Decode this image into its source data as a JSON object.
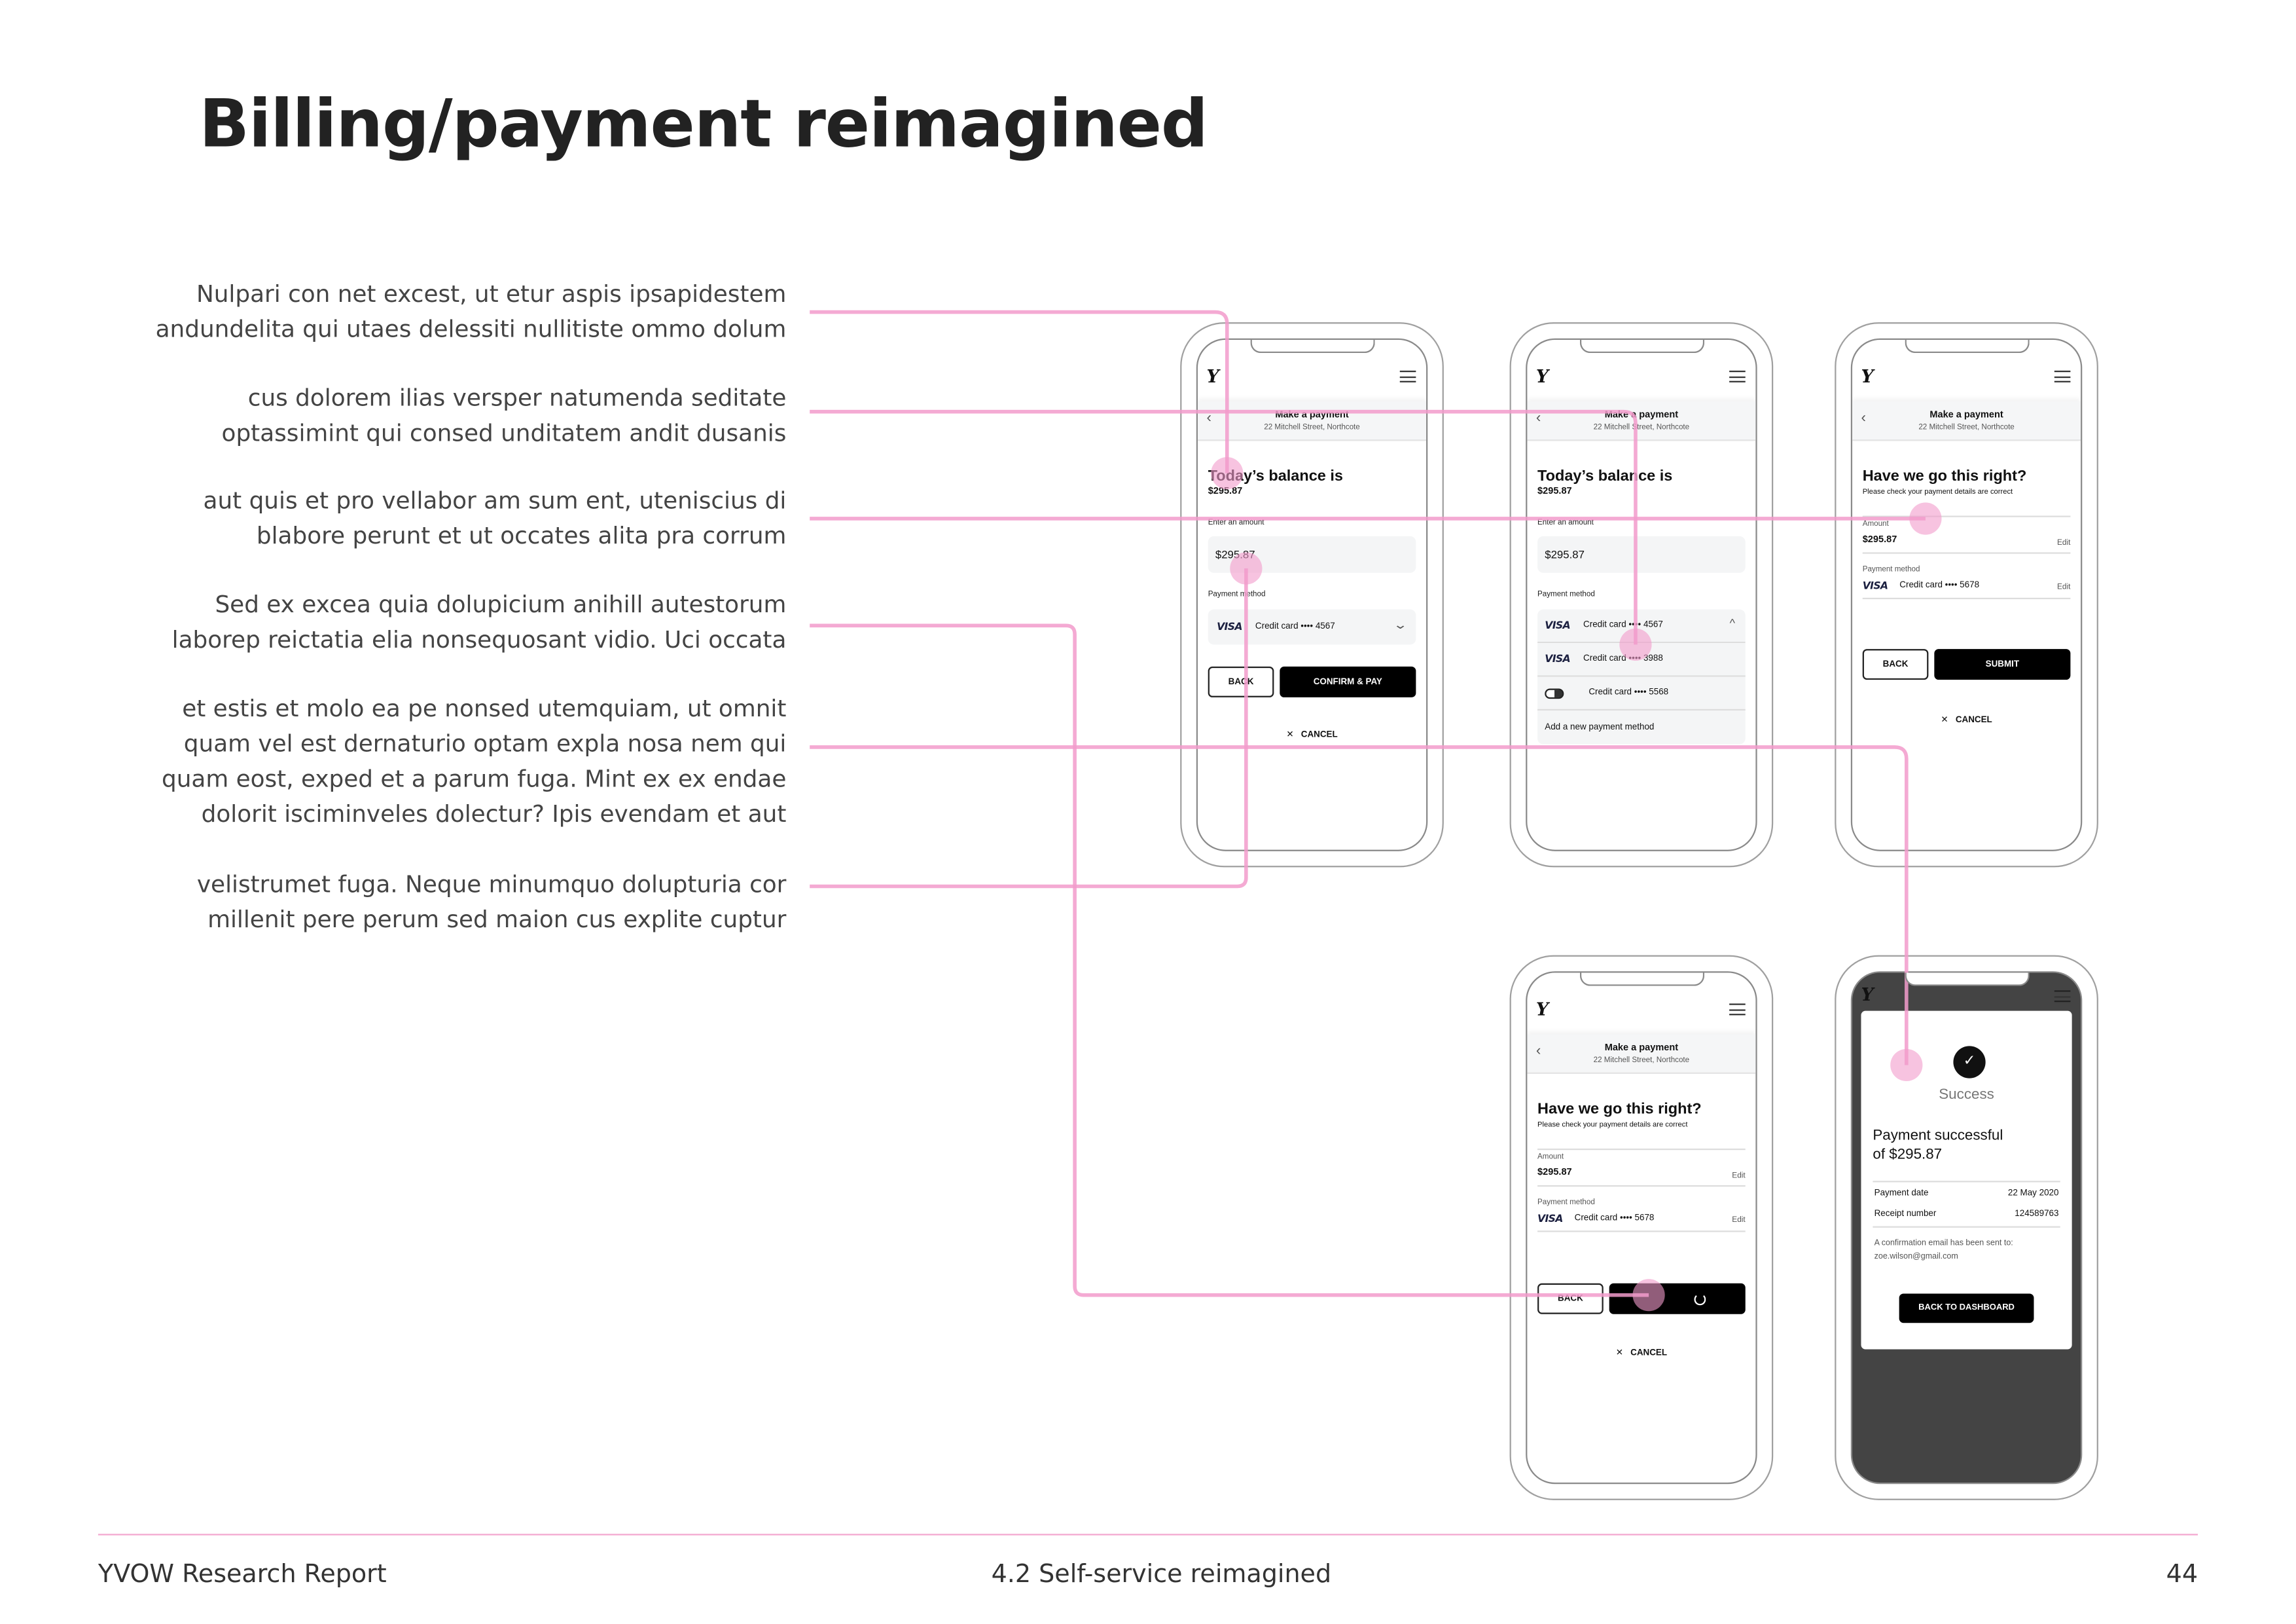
{
  "title": "Billing/payment reimagined",
  "intro": [
    [
      "Nulpari con net excest, ut etur aspis ipsapidestem",
      "andundelita qui utaes delessiti nullitiste ommo dolum"
    ],
    [
      "cus dolorem ilias versper natumenda seditate",
      "optassimint qui consed unditatem andit dusanis"
    ],
    [
      "aut quis et pro vellabor am sum ent, uteniscius di",
      "blabore perunt et ut occates alita pra corrum"
    ],
    [
      "Sed ex excea quia dolupicium anihill autestorum",
      "laborep reictatia elia nonsequosant vidio. Uci occata"
    ],
    [
      "et estis et molo ea pe nonsed utemquiam, ut omnit",
      "quam vel est dernaturio optam expla nosa nem qui",
      "quam eost, exped et a parum fuga. Mint ex ex endae",
      "dolorit isciminveles dolectur? Ipis evendam et aut"
    ],
    [
      "velistrumet fuga. Neque minumquo dolupturia cor",
      "millenit pere perum sed maion cus explite cuptur"
    ]
  ],
  "common": {
    "nav_title": "Make a payment",
    "nav_address": "22 Mitchell Street, Northcote",
    "balance_heading": "Today’s balance is",
    "balance": "$295.87",
    "enter_amount": "Enter an amount",
    "amount_value": "$295.87",
    "payment_method": "Payment method",
    "visa": "VISA",
    "back": "BACK",
    "cancel": "CANCEL",
    "review_heading": "Have we go this right?",
    "review_sub": "Please check your payment details are correct",
    "amount_label": "Amount",
    "edit": "Edit",
    "logo": "Y"
  },
  "screen1": {
    "selected_card": "Credit card •••• 4567",
    "confirm": "CONFIRM & PAY"
  },
  "screen2": {
    "cards": [
      "Credit card •••• 4567",
      "Credit card •••• 3988",
      "Credit card •••• 5568"
    ],
    "add_method": "Add a new payment method"
  },
  "screen3": {
    "card": "Credit card •••• 5678",
    "submit": "SUBMIT"
  },
  "screen4": {
    "card": "Credit card •••• 5678"
  },
  "screen5": {
    "status": "Success",
    "message_line1": "Payment successful",
    "message_line2": "of $295.87",
    "payment_date_label": "Payment date",
    "payment_date": "22 May 2020",
    "receipt_label": "Receipt number",
    "receipt": "124589763",
    "confirmation_line1": "A confirmation email has been sent to:",
    "email": "zoe.wilson@gmail.com",
    "back_dashboard": "BACK TO DASHBOARD"
  },
  "footer": {
    "left": "YVOW Research Report",
    "center": "4.2 Self-service reimagined",
    "page": "44"
  },
  "colors": {
    "annotation_pink": "#f29bcb",
    "dark_overlay": "#444444",
    "button": "#000000"
  }
}
